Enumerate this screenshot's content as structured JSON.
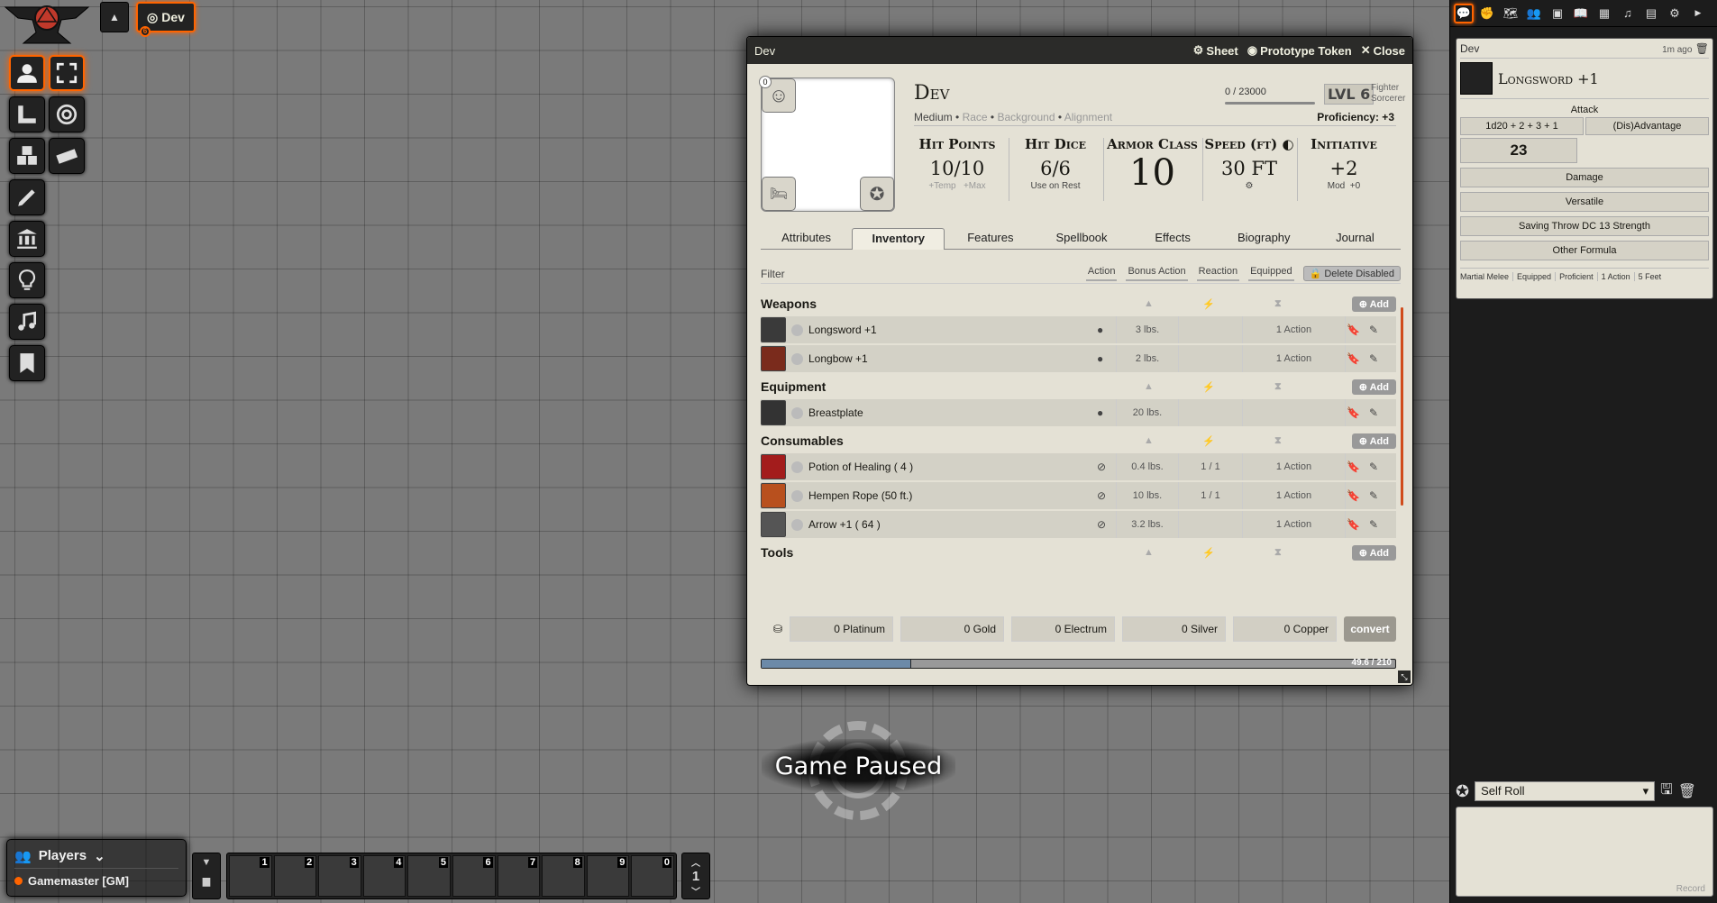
{
  "scene": {
    "tab_label": "Dev",
    "badge": "6"
  },
  "players": {
    "title": "Players",
    "gm": "Gamemaster [GM]"
  },
  "hotbar": {
    "slots": [
      "1",
      "2",
      "3",
      "4",
      "5",
      "6",
      "7",
      "8",
      "9",
      "0"
    ],
    "page": "1"
  },
  "paused": "Game Paused",
  "sheet": {
    "window_title": "Dev",
    "btn_sheet": "Sheet",
    "btn_token": "Prototype Token",
    "btn_close": "Close",
    "portrait_badge": "0",
    "name": "Dev",
    "xp": "0 / 23000",
    "level": "LVL 6",
    "classes": [
      "Fighter",
      "Sorcerer"
    ],
    "size": "Medium",
    "race": "Race",
    "background": "Background",
    "alignment": "Alignment",
    "proficiency": "Proficiency: +3",
    "hp": {
      "label": "Hit Points",
      "value": "10/10",
      "temp": "+Temp",
      "max": "+Max"
    },
    "hd": {
      "label": "Hit Dice",
      "value": "6/6",
      "sub": "Use on Rest"
    },
    "ac": {
      "label": "Armor Class",
      "value": "10"
    },
    "speed": {
      "label": "Speed (ft)",
      "value": "30 FT"
    },
    "init": {
      "label": "Initiative",
      "value": "+2",
      "mod": "Mod",
      "bonus": "+0"
    },
    "tabs": [
      "Attributes",
      "Inventory",
      "Features",
      "Spellbook",
      "Effects",
      "Biography",
      "Journal"
    ],
    "active_tab": "Inventory",
    "filter": {
      "label": "Filter",
      "options": [
        "Action",
        "Bonus Action",
        "Reaction",
        "Equipped"
      ],
      "delete": "Delete Disabled"
    },
    "add_label": "Add",
    "sections": [
      {
        "title": "Weapons",
        "items": [
          {
            "name": "Longsword +1",
            "weight": "3 lbs.",
            "uses": "",
            "action": "1 Action",
            "color": "#3a3a3a"
          },
          {
            "name": "Longbow +1",
            "weight": "2 lbs.",
            "uses": "",
            "action": "1 Action",
            "color": "#7a2b1c"
          }
        ]
      },
      {
        "title": "Equipment",
        "items": [
          {
            "name": "Breastplate",
            "weight": "20 lbs.",
            "uses": "",
            "action": "",
            "color": "#333"
          }
        ]
      },
      {
        "title": "Consumables",
        "items": [
          {
            "name": "Potion of Healing ( 4 )",
            "weight": "0.4 lbs.",
            "uses": "1 / 1",
            "action": "1 Action",
            "color": "#a31c1c"
          },
          {
            "name": "Hempen Rope (50 ft.)",
            "weight": "10 lbs.",
            "uses": "1 / 1",
            "action": "1 Action",
            "color": "#b8501e"
          },
          {
            "name": "Arrow +1 ( 64 )",
            "weight": "3.2 lbs.",
            "uses": "",
            "action": "1 Action",
            "color": "#555"
          }
        ]
      },
      {
        "title": "Tools",
        "items": []
      }
    ],
    "currency": [
      "0 Platinum",
      "0 Gold",
      "0 Electrum",
      "0 Silver",
      "0 Copper"
    ],
    "convert": "convert",
    "encumbrance": {
      "label": "49.6 / 210",
      "fraction": 0.236
    }
  },
  "chat": {
    "speaker": "Dev",
    "time": "1m ago",
    "item": "Longsword +1",
    "attack_label": "Attack",
    "formula": "1d20 + 2 + 3 + 1",
    "advantage": "(Dis)Advantage",
    "total": "23",
    "damage": "Damage",
    "versatile": "Versatile",
    "save": "Saving Throw DC 13 Strength",
    "other": "Other Formula",
    "tags": [
      "Martial Melee",
      "Equipped",
      "Proficient",
      "1 Action",
      "5 Feet"
    ],
    "roll_mode": "Self Roll",
    "record": "Record"
  },
  "colors": {
    "accent": "#ff6400",
    "sheet_bg": "#e4e1d5",
    "dark": "#222222"
  }
}
